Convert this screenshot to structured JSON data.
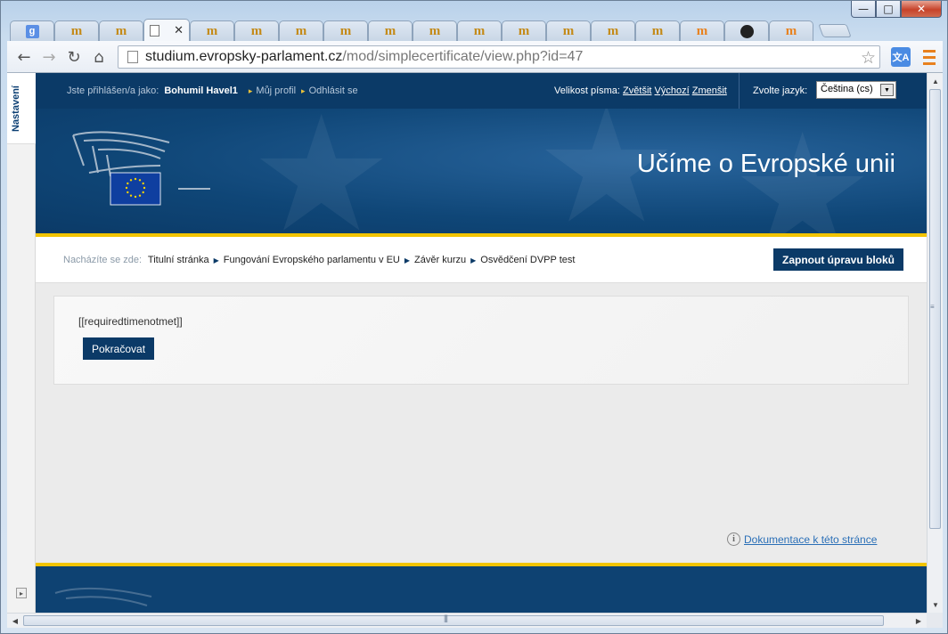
{
  "window": {
    "controls": {
      "minimize": "—",
      "maximize": "□",
      "close": "✕"
    }
  },
  "tabs": [
    {
      "icon": "google-g-icon",
      "glyph": "g"
    },
    {
      "icon": "moodle-icon",
      "glyph": "m"
    },
    {
      "icon": "moodle-icon",
      "glyph": "m"
    },
    {
      "icon": "document-icon",
      "glyph": "",
      "active": true,
      "close": "✕"
    },
    {
      "icon": "moodle-icon",
      "glyph": "m"
    },
    {
      "icon": "moodle-icon",
      "glyph": "m"
    },
    {
      "icon": "moodle-icon",
      "glyph": "m"
    },
    {
      "icon": "moodle-icon",
      "glyph": "m"
    },
    {
      "icon": "moodle-icon",
      "glyph": "m"
    },
    {
      "icon": "moodle-icon",
      "glyph": "m"
    },
    {
      "icon": "moodle-icon",
      "glyph": "m"
    },
    {
      "icon": "moodle-icon",
      "glyph": "m"
    },
    {
      "icon": "moodle-icon",
      "glyph": "m"
    },
    {
      "icon": "moodle-icon",
      "glyph": "m"
    },
    {
      "icon": "moodle-icon",
      "glyph": "m"
    },
    {
      "icon": "moodle-orange-icon",
      "glyph": "m"
    },
    {
      "icon": "github-icon",
      "glyph": ""
    },
    {
      "icon": "moodle-orange-icon",
      "glyph": "m"
    }
  ],
  "toolbar": {
    "back": "←",
    "forward": "→",
    "reload": "↻",
    "home": "⌂",
    "url_host": "studium.evropsky-parlament.cz",
    "url_path": "/mod/simplecertificate/view.php?id=47",
    "bookmark_star": "☆",
    "translate": "文A"
  },
  "settings": {
    "label": "Nastavení",
    "expand": "▸"
  },
  "topbar": {
    "logged_in_label": "Jste přihlášen/a jako:",
    "user_name": "Bohumil Havel1",
    "profile_link": "Můj profil",
    "logout_link": "Odhlásit se",
    "font_size_label": "Velikost písma:",
    "font_bigger": "Zvětšit",
    "font_default": "Výchozí",
    "font_smaller": "Zmenšit",
    "language_label": "Zvolte jazyk:",
    "language_value": "Čeština (cs)"
  },
  "banner": {
    "title": "Učíme o Evropské unii"
  },
  "breadcrumb": {
    "lead": "Nacházíte se zde:",
    "items": [
      "Titulní stránka",
      "Fungování Evropského parlamentu v EU",
      "Závěr kurzu",
      "Osvědčení DVPP test"
    ]
  },
  "edit_blocks_button": "Zapnout úpravu bloků",
  "content": {
    "message": "[[requiredtimenotmet]]",
    "continue_button": "Pokračovat"
  },
  "docs": {
    "link": "Dokumentace k této stránce"
  },
  "colors": {
    "primary": "#0b3a67",
    "accent_yellow": "#f2c400",
    "link": "#2a6fb7"
  }
}
